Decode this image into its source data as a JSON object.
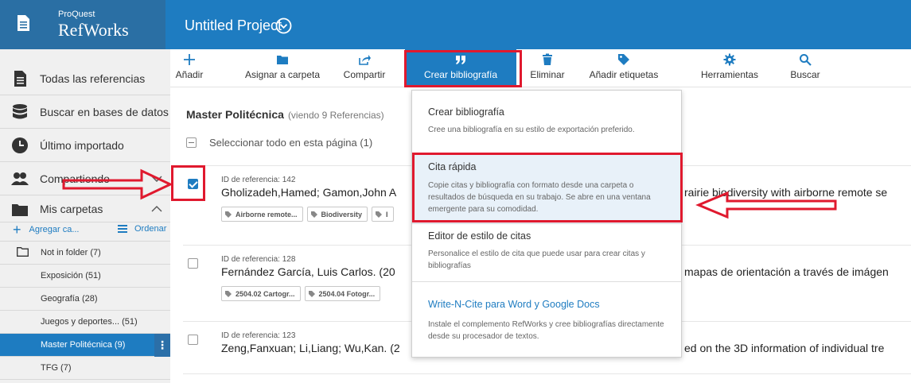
{
  "header": {
    "logo_top": "ProQuest",
    "logo_bottom": "RefWorks",
    "project_title": "Untitled Project"
  },
  "sidebar": {
    "items": [
      {
        "label": "Todas las referencias"
      },
      {
        "label": "Buscar en bases de datos"
      },
      {
        "label": "Último importado"
      },
      {
        "label": "Compartiendo"
      },
      {
        "label": "Mis carpetas"
      }
    ],
    "add_folder": "Agregar ca...",
    "order": "Ordenar",
    "folders": [
      {
        "label": "Not in folder (7)"
      },
      {
        "label": "Exposición (51)"
      },
      {
        "label": "Geografía (28)"
      },
      {
        "label": "Juegos y deportes... (51)"
      },
      {
        "label": "Master Politécnica (9)",
        "selected": true
      },
      {
        "label": "TFG (7)"
      }
    ]
  },
  "toolbar": {
    "buttons": [
      {
        "label": "Añadir",
        "icon": "plus-icon"
      },
      {
        "label": "Asignar a carpeta",
        "icon": "folder-icon"
      },
      {
        "label": "Compartir",
        "icon": "share-icon"
      },
      {
        "label": "Crear bibliografía",
        "icon": "quote-icon",
        "active": true
      },
      {
        "label": "Eliminar",
        "icon": "trash-icon"
      },
      {
        "label": "Añadir etiquetas",
        "icon": "tag-icon"
      },
      {
        "label": "Herramientas",
        "icon": "gear-icon"
      },
      {
        "label": "Buscar",
        "icon": "search-icon"
      }
    ]
  },
  "content": {
    "title": "Master Politécnica",
    "subtitle": "(viendo 9 Referencias)",
    "select_all": "Seleccionar todo en esta página (1)",
    "references": [
      {
        "id": "ID de referencia: 142",
        "main": "Gholizadeh,Hamed; Gamon,John A",
        "right": "rairie biodiversity with airborne remote se",
        "tags": [
          "Airborne remote...",
          "Biodiversity",
          "I"
        ],
        "checked": true
      },
      {
        "id": "ID de referencia: 128",
        "main": "Fernández García, Luis Carlos. (20",
        "right": "mapas de orientación a través de imágen",
        "tags": [
          "2504.02 Cartogr...",
          "2504.04 Fotogr..."
        ],
        "checked": false
      },
      {
        "id": "ID de referencia: 123",
        "main": "Zeng,Fanxuan; Li,Liang; Wu,Kan. (2",
        "right": "ed on the 3D information of individual tre",
        "tags": [],
        "checked": false
      }
    ]
  },
  "dropdown": {
    "items": [
      {
        "title": "Crear bibliografía",
        "desc": "Cree una bibliografía en su estilo de exportación preferido."
      },
      {
        "title": "Cita rápida",
        "desc": "Copie citas y bibliografía con formato desde una carpeta o resultados de búsqueda en su trabajo. Se abre en una ventana emergente para su comodidad."
      },
      {
        "title": "Editor de estilo de citas",
        "desc": "Personalice el estilo de cita que puede usar para crear citas y bibliografías"
      },
      {
        "title": "Write-N-Cite para Word y Google Docs",
        "desc": "Instale el complemento RefWorks y cree bibliografías directamente desde su procesador de textos."
      }
    ]
  },
  "colors": {
    "brand": "#1e7cc1",
    "annotation_red": "#e0192e",
    "highlight": "#e8f1f9"
  }
}
